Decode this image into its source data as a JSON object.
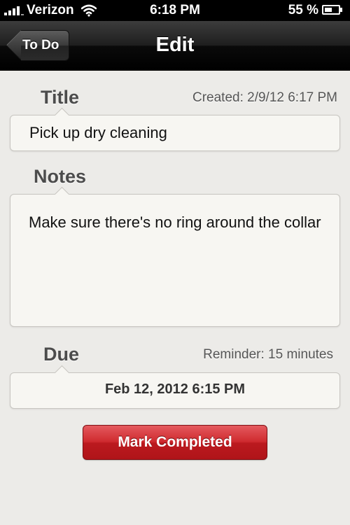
{
  "status_bar": {
    "carrier": "Verizon",
    "time": "6:18 PM",
    "battery_percent": "55 %",
    "battery_level": 0.55
  },
  "nav": {
    "back_label": "To Do",
    "title": "Edit"
  },
  "title_section": {
    "label": "Title",
    "created": "Created: 2/9/12 6:17 PM",
    "value": "Pick up dry cleaning"
  },
  "notes_section": {
    "label": "Notes",
    "value": "Make sure there's no ring around the collar"
  },
  "due_section": {
    "label": "Due",
    "reminder": "Reminder: 15 minutes",
    "value": "Feb 12, 2012 6:15 PM"
  },
  "actions": {
    "mark_completed": "Mark Completed"
  },
  "colors": {
    "accent_red": "#cf2a2f",
    "nav_bar": "#1e1e1e",
    "background": "#ecebe8"
  },
  "icons": [
    "signal-icon",
    "wifi-icon",
    "battery-icon"
  ]
}
